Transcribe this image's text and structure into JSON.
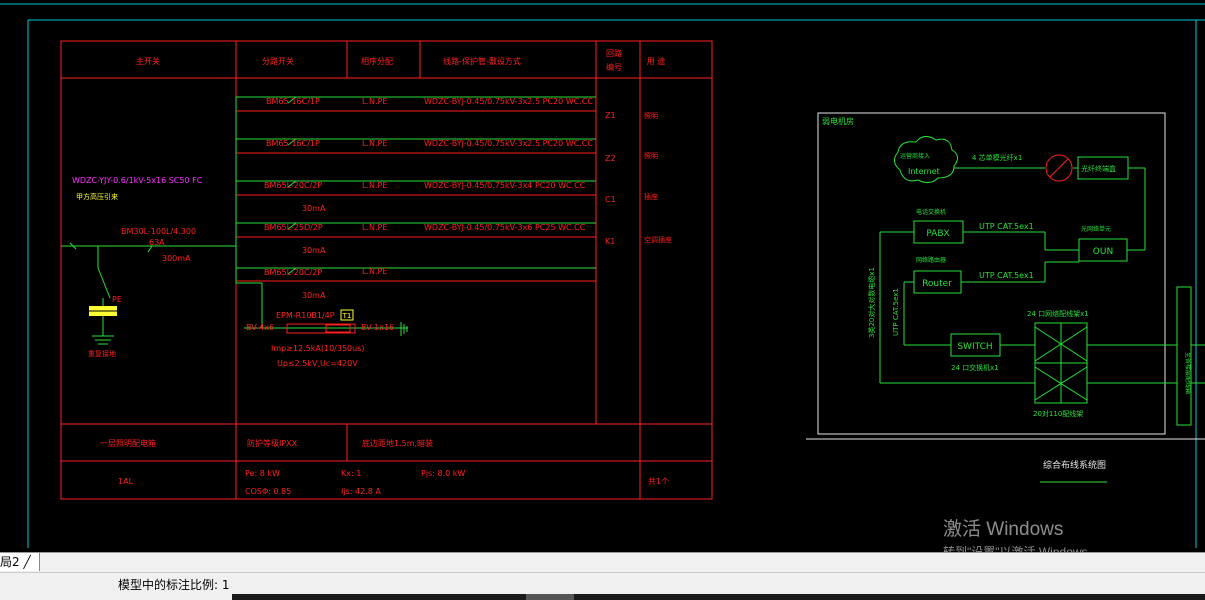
{
  "colors": {
    "red": "#ff2020",
    "green": "#27e03a",
    "yellow": "#ffff33",
    "magenta": "#ff30ff",
    "white": "#e6e6e6",
    "cyan": "#00c8d8"
  },
  "panel": {
    "headers": {
      "main_switch": "主开关",
      "branch_switch": "分路开关",
      "phase": "相序分配",
      "cable": "线路-保护管-敷设方式",
      "circuit_no_line1": "回路",
      "circuit_no_line2": "编号",
      "usage": "用 途"
    },
    "incoming_cable": "WDZC-YJY-0.6/1kV-5x16 SC50 FC",
    "incoming_note": "甲方高压引来",
    "main_breaker": "BM30L-100L/4.300",
    "main_breaker_amp": "63A",
    "main_breaker_rcd": "300mA",
    "pe_label": "PE",
    "ground_label": "重复接地",
    "circuits": [
      {
        "breaker": "BM65-16C/1P",
        "phase": "L.N.PE",
        "cable": "WDZC-BYJ-0.45/0.75kV-3x2.5 PC20 WC.CC",
        "no": "Z1",
        "usage": "照明",
        "rcd": ""
      },
      {
        "breaker": "BM65-16C/1P",
        "phase": "L.N.PE",
        "cable": "WDZC-BYJ-0.45/0.75kV-3x2.5 PC20 WC.CC",
        "no": "Z2",
        "usage": "照明",
        "rcd": ""
      },
      {
        "breaker": "BM65L-20C/2P",
        "phase": "L.N.PE",
        "cable": "WDZC-BYJ-0.45/0.75kV-3x4 PC20 WC.CC",
        "no": "C1",
        "usage": "插座",
        "rcd": "30mA"
      },
      {
        "breaker": "BM65L-25D/2P",
        "phase": "L.N.PE",
        "cable": "WDZC-BYJ-0.45/0.75kV-3x6 PC25 WC.CC",
        "no": "K1",
        "usage": "空调插座",
        "rcd": "30mA"
      },
      {
        "breaker": "BM65L-20C/2P",
        "phase": "L.N.PE",
        "cable": "",
        "no": "",
        "usage": "",
        "rcd": "30mA"
      }
    ],
    "spd": {
      "model": "EPM-R10B1/4P",
      "box": "T1",
      "left_wire": "BV-4x6",
      "right_wire": "BV-1x16",
      "spec1": "Imp≥12.5kA(10/350us)",
      "spec2": "Up≤2.5kV,Uc=420V"
    },
    "footer": {
      "location": "一层照明配电箱",
      "protection": "防护等级IPXX",
      "mounting": "底边距地1.5m,暗装",
      "box_id": "1AL",
      "pe": "Pe: 8  kW",
      "kx": "Kx: 1",
      "pjs": "Pjs: 8.0  kW",
      "cos": "COSΦ: 0.85",
      "ijs": "Ijs: 42.8  A",
      "count": "共1个"
    }
  },
  "cabling": {
    "room_label": "弱电机房",
    "internet_line1": "运营商接入",
    "internet_line2": "Internet",
    "fiber_label": "4 芯单模光纤x1",
    "odf_label": "光纤终端盒",
    "pabx_caption": "电话交换机",
    "pabx": "PABX",
    "pabx_cable": "UTP CAT.5ex1",
    "oun_caption": "光网络单元",
    "oun": "OUN",
    "router_caption": "网络路由器",
    "router": "Router",
    "router_cable": "UTP CAT.5ex1",
    "left_vert_a": "3类20对大对数电缆x1",
    "left_vert_b": "UTP CAT.5ex1",
    "switch": "SWITCH",
    "switch_caption": "24 口交换机x1",
    "patch_top": "24 口网络配线架x1",
    "patch_bottom": "20对110配线架",
    "right_vertical": "至各楼层配线箱",
    "title": "综合布线系统图"
  },
  "tab": {
    "label": "局2"
  },
  "status": {
    "scale": "模型中的标注比例: 1"
  },
  "watermark": {
    "title": "激活 Windows",
    "subtitle": "转到\"设置\"以激活 Windows。"
  }
}
